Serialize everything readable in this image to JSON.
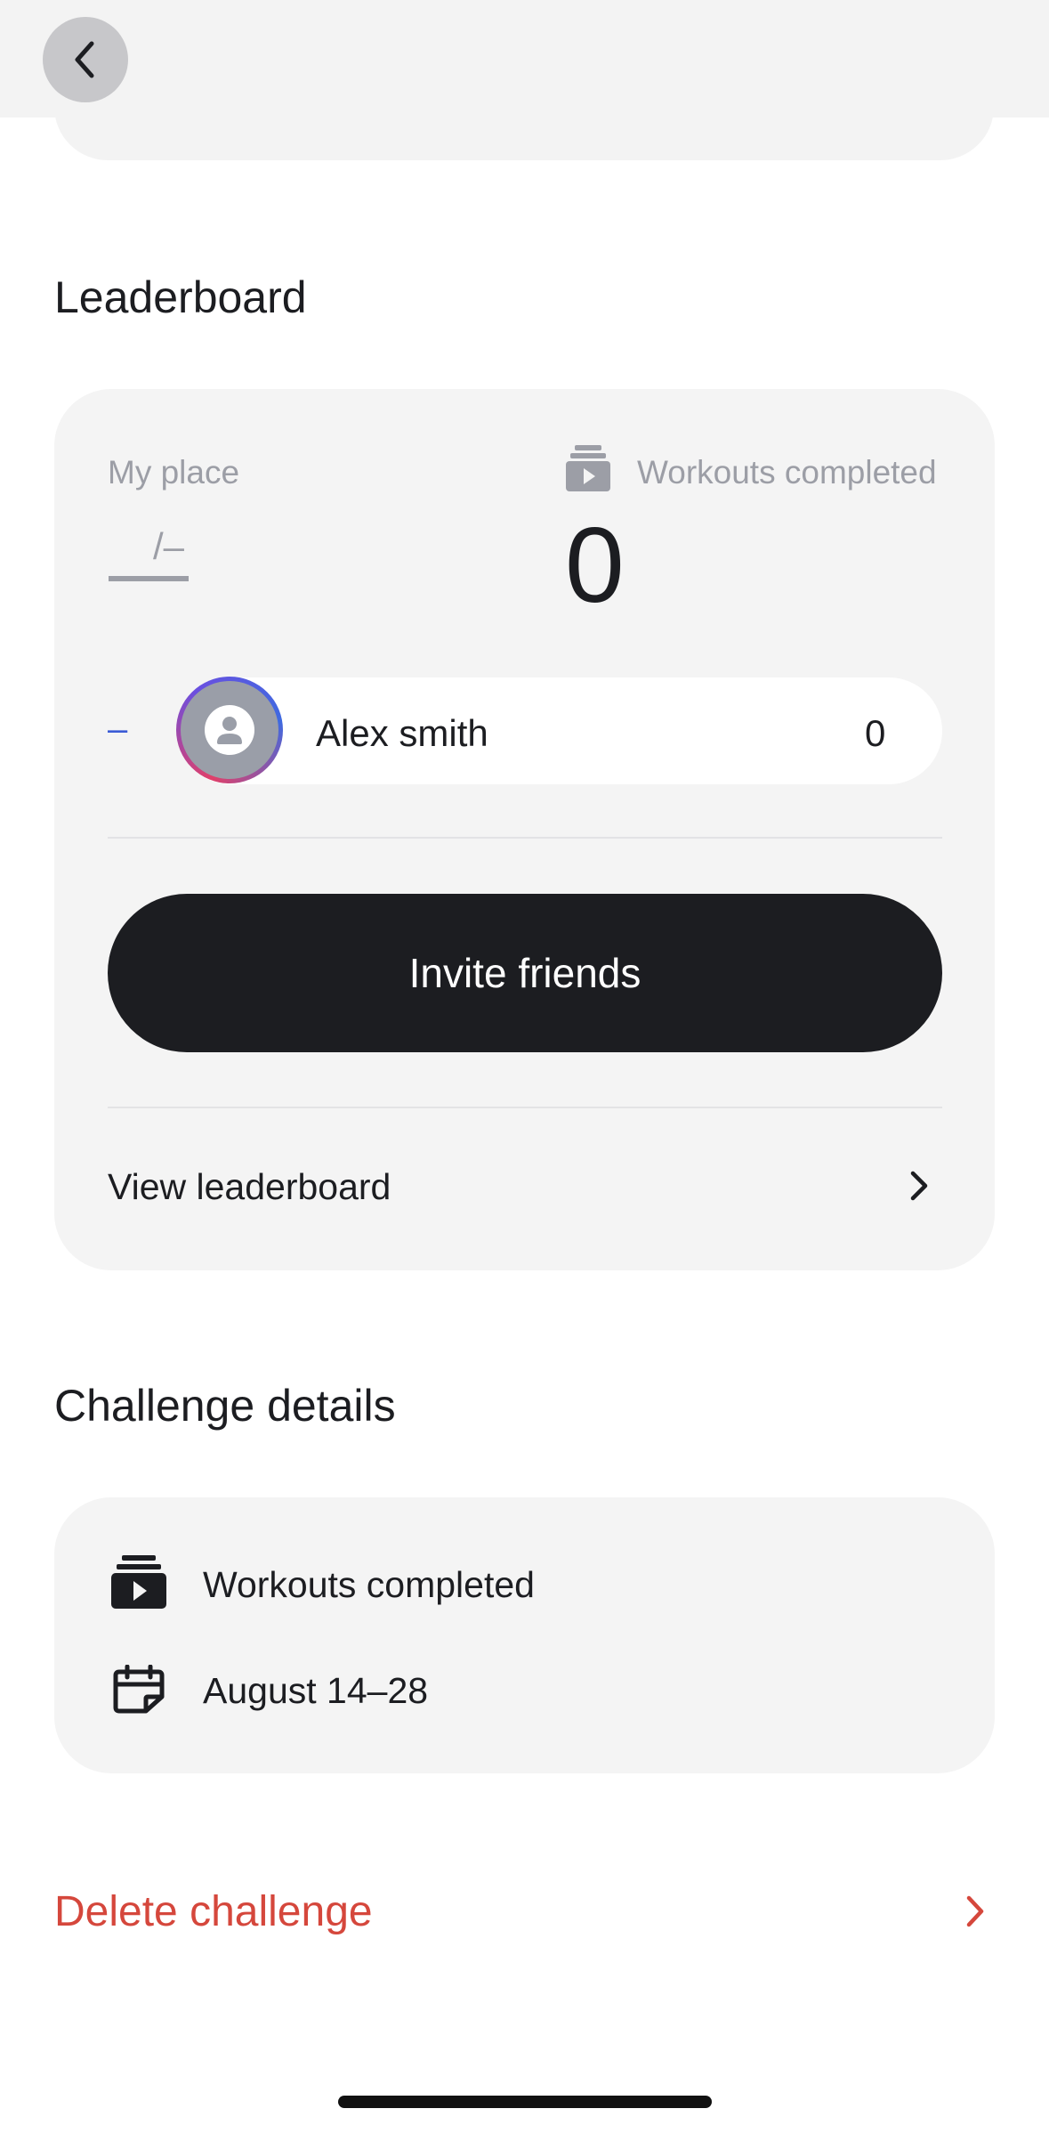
{
  "leaderboard": {
    "title": "Leaderboard",
    "my_place_label": "My place",
    "my_place_value": "—",
    "my_place_total": "/–",
    "workouts_label": "Workouts completed",
    "workouts_value": "0",
    "user": {
      "rank": "–",
      "name": "Alex smith",
      "score": "0"
    },
    "invite_label": "Invite friends",
    "view_label": "View leaderboard"
  },
  "details": {
    "title": "Challenge details",
    "items": [
      {
        "icon": "workouts-stack-icon",
        "text": "Workouts completed"
      },
      {
        "icon": "calendar-icon",
        "text": "August 14–28"
      }
    ]
  },
  "delete_label": "Delete challenge",
  "colors": {
    "accent_danger": "#d5473c",
    "rank_blue": "#3b5bd6",
    "button_dark": "#1c1d21",
    "card_bg": "#f4f4f4"
  }
}
